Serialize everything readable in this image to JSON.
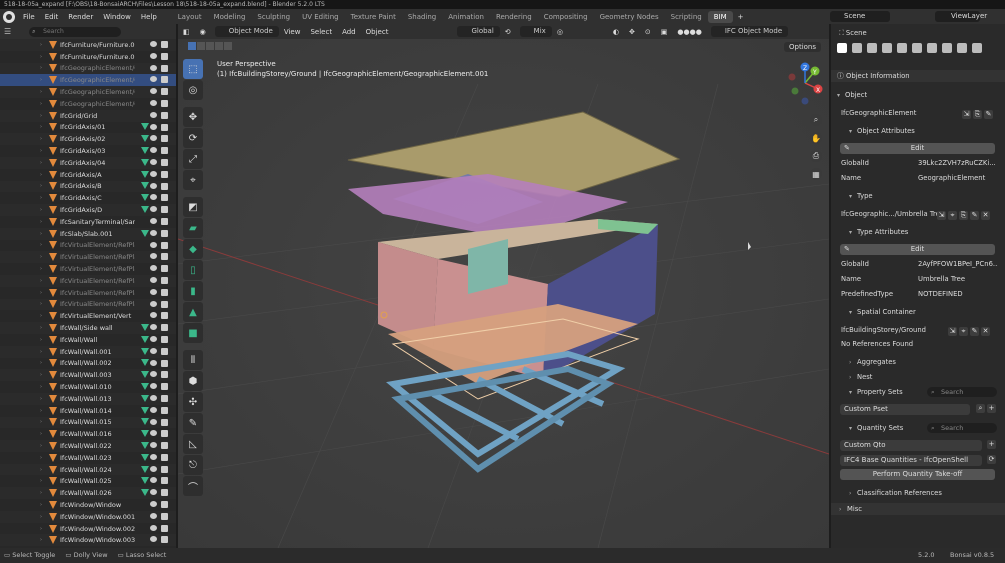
{
  "window_title": "518-18-05a_expand [F:\\OBS\\18-BonsaiARCH\\Files\\Lesson 18\\518-18-05a_expand.blend] - Blender 5.2.0 LTS",
  "menu": [
    "File",
    "Edit",
    "Render",
    "Window",
    "Help"
  ],
  "workspaces": [
    "Layout",
    "Modeling",
    "Sculpting",
    "UV Editing",
    "Texture Paint",
    "Shading",
    "Animation",
    "Rendering",
    "Compositing",
    "Geometry Nodes",
    "Scripting",
    "BIM"
  ],
  "active_workspace": "BIM",
  "scene_name": "Scene",
  "view_layer": "ViewLayer",
  "outliner": {
    "search_placeholder": "Search",
    "rows": [
      {
        "label": "IfcFurniture/Furniture.00",
        "mesh": false,
        "dim": false,
        "sel": false
      },
      {
        "label": "IfcFurniture/Furniture.00",
        "mesh": false,
        "dim": false,
        "sel": false
      },
      {
        "label": "IfcGeographicElement/G",
        "mesh": false,
        "dim": true,
        "sel": false
      },
      {
        "label": "IfcGeographicElement/G",
        "mesh": false,
        "dim": true,
        "sel": true
      },
      {
        "label": "IfcGeographicElement/G",
        "mesh": false,
        "dim": true,
        "sel": false
      },
      {
        "label": "IfcGeographicElement/G",
        "mesh": false,
        "dim": true,
        "sel": false
      },
      {
        "label": "IfcGrid/Grid",
        "mesh": false,
        "dim": false,
        "sel": false
      },
      {
        "label": "IfcGridAxis/01",
        "mesh": true,
        "dim": false,
        "sel": false
      },
      {
        "label": "IfcGridAxis/02",
        "mesh": true,
        "dim": false,
        "sel": false
      },
      {
        "label": "IfcGridAxis/03",
        "mesh": true,
        "dim": false,
        "sel": false
      },
      {
        "label": "IfcGridAxis/04",
        "mesh": true,
        "dim": false,
        "sel": false
      },
      {
        "label": "IfcGridAxis/A",
        "mesh": true,
        "dim": false,
        "sel": false
      },
      {
        "label": "IfcGridAxis/B",
        "mesh": true,
        "dim": false,
        "sel": false
      },
      {
        "label": "IfcGridAxis/C",
        "mesh": true,
        "dim": false,
        "sel": false
      },
      {
        "label": "IfcGridAxis/D",
        "mesh": true,
        "dim": false,
        "sel": false
      },
      {
        "label": "IfcSanitaryTerminal/Sani",
        "mesh": false,
        "dim": false,
        "sel": false
      },
      {
        "label": "IfcSlab/Slab.001",
        "mesh": true,
        "dim": false,
        "sel": false
      },
      {
        "label": "IfcVirtualElement/RefPla",
        "mesh": false,
        "dim": true,
        "sel": false
      },
      {
        "label": "IfcVirtualElement/RefPla",
        "mesh": false,
        "dim": true,
        "sel": false
      },
      {
        "label": "IfcVirtualElement/RefPla",
        "mesh": false,
        "dim": true,
        "sel": false
      },
      {
        "label": "IfcVirtualElement/RefPla",
        "mesh": false,
        "dim": true,
        "sel": false
      },
      {
        "label": "IfcVirtualElement/RefPla",
        "mesh": false,
        "dim": true,
        "sel": false
      },
      {
        "label": "IfcVirtualElement/RefPla",
        "mesh": false,
        "dim": true,
        "sel": false
      },
      {
        "label": "IfcVirtualElement/Vert",
        "mesh": false,
        "dim": false,
        "sel": false
      },
      {
        "label": "IfcWall/Side wall",
        "mesh": true,
        "dim": false,
        "sel": false
      },
      {
        "label": "IfcWall/Wall",
        "mesh": true,
        "dim": false,
        "sel": false
      },
      {
        "label": "IfcWall/Wall.001",
        "mesh": true,
        "dim": false,
        "sel": false
      },
      {
        "label": "IfcWall/Wall.002",
        "mesh": true,
        "dim": false,
        "sel": false
      },
      {
        "label": "IfcWall/Wall.003",
        "mesh": true,
        "dim": false,
        "sel": false
      },
      {
        "label": "IfcWall/Wall.010",
        "mesh": true,
        "dim": false,
        "sel": false
      },
      {
        "label": "IfcWall/Wall.013",
        "mesh": true,
        "dim": false,
        "sel": false
      },
      {
        "label": "IfcWall/Wall.014",
        "mesh": true,
        "dim": false,
        "sel": false
      },
      {
        "label": "IfcWall/Wall.015",
        "mesh": true,
        "dim": false,
        "sel": false
      },
      {
        "label": "IfcWall/Wall.016",
        "mesh": true,
        "dim": false,
        "sel": false
      },
      {
        "label": "IfcWall/Wall.022",
        "mesh": true,
        "dim": false,
        "sel": false
      },
      {
        "label": "IfcWall/Wall.023",
        "mesh": true,
        "dim": false,
        "sel": false
      },
      {
        "label": "IfcWall/Wall.024",
        "mesh": true,
        "dim": false,
        "sel": false
      },
      {
        "label": "IfcWall/Wall.025",
        "mesh": true,
        "dim": false,
        "sel": false
      },
      {
        "label": "IfcWall/Wall.026",
        "mesh": true,
        "dim": false,
        "sel": false
      },
      {
        "label": "IfcWindow/Window",
        "mesh": false,
        "dim": false,
        "sel": false
      },
      {
        "label": "IfcWindow/Window.001",
        "mesh": false,
        "dim": false,
        "sel": false
      },
      {
        "label": "IfcWindow/Window.002",
        "mesh": false,
        "dim": false,
        "sel": false
      },
      {
        "label": "IfcWindow/Window.003",
        "mesh": false,
        "dim": false,
        "sel": false
      }
    ]
  },
  "viewport": {
    "mode": "Object Mode",
    "menus": [
      "View",
      "Select",
      "Add",
      "Object"
    ],
    "orientation": "Global",
    "pivot": "Mix",
    "ifc_mode": "IFC Object Mode",
    "options": "Options",
    "perspective_label": "User Perspective",
    "context_label": "(1) IfcBuildingStorey/Ground | IfcGeographicElement/GeographicElement.001",
    "gizmo_axes": {
      "x": "X",
      "y": "Y",
      "z": "Z"
    }
  },
  "properties": {
    "scene_label": "Scene",
    "panel_title": "Object Information",
    "object_section": "Object",
    "object_class": "IfcGeographicElement",
    "object_attributes": "Object Attributes",
    "edit": "Edit",
    "attrs": [
      {
        "k": "GlobalId",
        "v": "39Lkc2ZVH7zRuCZKi..."
      },
      {
        "k": "Name",
        "v": "GeographicElement"
      }
    ],
    "type_section": "Type",
    "type_value": "IfcGeographic.../Umbrella Tree",
    "type_attributes": "Type Attributes",
    "type_attrs": [
      {
        "k": "GlobalId",
        "v": "2AyfPFOW1BPeI_PCn6..."
      },
      {
        "k": "Name",
        "v": "Umbrella Tree"
      },
      {
        "k": "PredefinedType",
        "v": "NOTDEFINED"
      }
    ],
    "spatial_container": "Spatial Container",
    "storey": "IfcBuildingStorey/Ground",
    "no_refs": "No References Found",
    "aggregates": "Aggregates",
    "nest": "Nest",
    "property_sets": "Property Sets",
    "search": "Search",
    "custom_pset": "Custom Pset",
    "quantity_sets": "Quantity Sets",
    "custom_qto": "Custom Qto",
    "qto_select": "IFC4 Base Quantities - IfcOpenShell",
    "perform_qto": "Perform Quantity Take-off",
    "classification": "Classification References",
    "misc": "Misc"
  },
  "status": {
    "items": [
      "Select Toggle",
      "Dolly View",
      "Lasso Select"
    ],
    "version": "5.2.0",
    "bonsai": "Bonsai v0.8.5"
  },
  "colors": {
    "selected_row": "#334d80",
    "accent": "#4772b3",
    "ifc_icon": "#e38a3c",
    "mesh_icon": "#3bb88a"
  }
}
